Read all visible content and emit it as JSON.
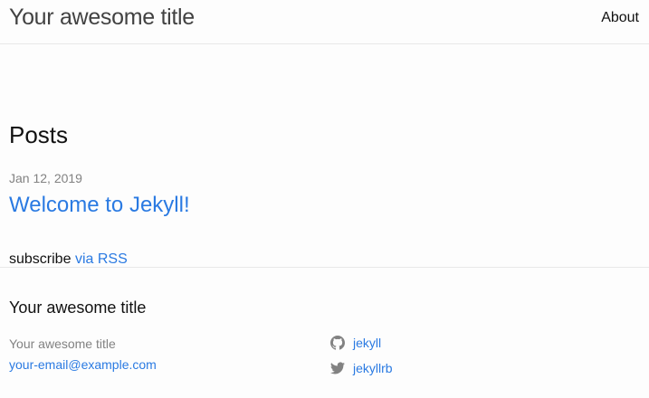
{
  "header": {
    "site_title": "Your awesome title",
    "nav": [
      {
        "label": "About"
      }
    ]
  },
  "main": {
    "heading": "Posts",
    "posts": [
      {
        "date": "Jan 12, 2019",
        "title": "Welcome to Jekyll!"
      }
    ],
    "subscribe_text": "subscribe",
    "rss_link_text": "via RSS"
  },
  "footer": {
    "heading": "Your awesome title",
    "name": "Your awesome title",
    "email": "your-email@example.com",
    "social": [
      {
        "icon": "github-icon",
        "label": "jekyll"
      },
      {
        "icon": "twitter-icon",
        "label": "jekyllrb"
      }
    ]
  },
  "colors": {
    "link": "#2a7ae2",
    "text": "#111111",
    "muted": "#828282",
    "icon": "#828282",
    "border": "#e8e8e8",
    "background": "#fdfdfd"
  }
}
